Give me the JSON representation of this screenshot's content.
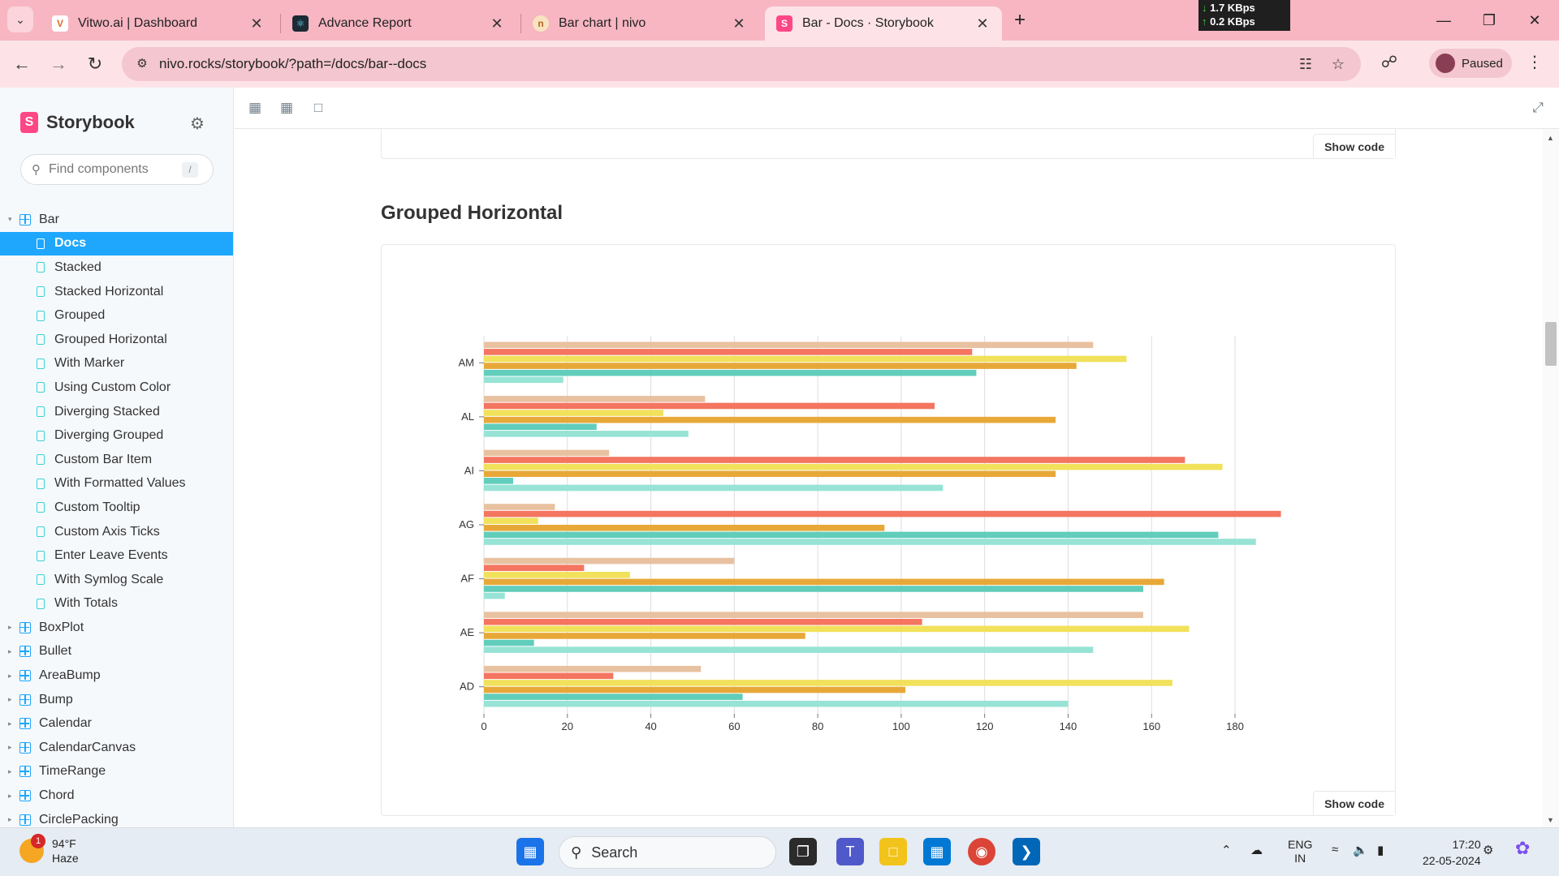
{
  "browser": {
    "tabs": [
      {
        "title": "Vitwo.ai | Dashboard",
        "favicon": "vitwo-icon"
      },
      {
        "title": "Advance Report",
        "favicon": "react-icon"
      },
      {
        "title": "Bar chart | nivo",
        "favicon": "nivo-icon"
      },
      {
        "title": "Bar - Docs · Storybook",
        "favicon": "storybook-icon",
        "active": true
      }
    ],
    "url": "nivo.rocks/storybook/?path=/docs/bar--docs",
    "profile_label": "Paused",
    "net_down": "1.7 KBps",
    "net_up": "0.2 KBps"
  },
  "sidebar": {
    "brand": "Storybook",
    "search_placeholder": "Find components",
    "search_shortcut": "/",
    "items": [
      {
        "type": "group",
        "label": "Bar",
        "expanded": true
      },
      {
        "type": "story",
        "label": "Docs",
        "active": true
      },
      {
        "type": "story",
        "label": "Stacked"
      },
      {
        "type": "story",
        "label": "Stacked Horizontal"
      },
      {
        "type": "story",
        "label": "Grouped"
      },
      {
        "type": "story",
        "label": "Grouped Horizontal"
      },
      {
        "type": "story",
        "label": "With Marker"
      },
      {
        "type": "story",
        "label": "Using Custom Color"
      },
      {
        "type": "story",
        "label": "Diverging Stacked"
      },
      {
        "type": "story",
        "label": "Diverging Grouped"
      },
      {
        "type": "story",
        "label": "Custom Bar Item"
      },
      {
        "type": "story",
        "label": "With Formatted Values"
      },
      {
        "type": "story",
        "label": "Custom Tooltip"
      },
      {
        "type": "story",
        "label": "Custom Axis Ticks"
      },
      {
        "type": "story",
        "label": "Enter Leave Events"
      },
      {
        "type": "story",
        "label": "With Symlog Scale"
      },
      {
        "type": "story",
        "label": "With Totals"
      },
      {
        "type": "group",
        "label": "BoxPlot"
      },
      {
        "type": "group",
        "label": "Bullet"
      },
      {
        "type": "group",
        "label": "AreaBump"
      },
      {
        "type": "group",
        "label": "Bump"
      },
      {
        "type": "group",
        "label": "Calendar"
      },
      {
        "type": "group",
        "label": "CalendarCanvas"
      },
      {
        "type": "group",
        "label": "TimeRange"
      },
      {
        "type": "group",
        "label": "Chord"
      },
      {
        "type": "group",
        "label": "CirclePacking"
      }
    ]
  },
  "docs": {
    "show_code_label": "Show code",
    "section_title": "Grouped Horizontal"
  },
  "chart_data": {
    "type": "bar",
    "orientation": "horizontal",
    "grouped": true,
    "categories": [
      "AM",
      "AL",
      "AI",
      "AG",
      "AF",
      "AE",
      "AD"
    ],
    "xlim": [
      0,
      180
    ],
    "xticks": [
      0,
      20,
      40,
      60,
      80,
      100,
      120,
      140,
      160,
      180
    ],
    "grid": true,
    "series": [
      {
        "color": "#e8c1a0",
        "values": [
          146,
          53,
          30,
          17,
          60,
          158,
          52
        ]
      },
      {
        "color": "#f47560",
        "values": [
          117,
          108,
          168,
          191,
          24,
          105,
          31
        ]
      },
      {
        "color": "#f1e15b",
        "values": [
          154,
          43,
          177,
          13,
          35,
          169,
          165
        ]
      },
      {
        "color": "#e8a838",
        "values": [
          142,
          137,
          137,
          96,
          163,
          77,
          101
        ]
      },
      {
        "color": "#61cdbb",
        "values": [
          118,
          27,
          7,
          176,
          158,
          12,
          62
        ]
      },
      {
        "color": "#97e3d5",
        "values": [
          19,
          49,
          110,
          185,
          5,
          146,
          140
        ]
      }
    ]
  },
  "taskbar": {
    "weather_temp": "94°F",
    "weather_desc": "Haze",
    "weather_badge": "1",
    "search_label": "Search",
    "lang_top": "ENG",
    "lang_bottom": "IN",
    "time": "17:20",
    "date": "22-05-2024"
  }
}
